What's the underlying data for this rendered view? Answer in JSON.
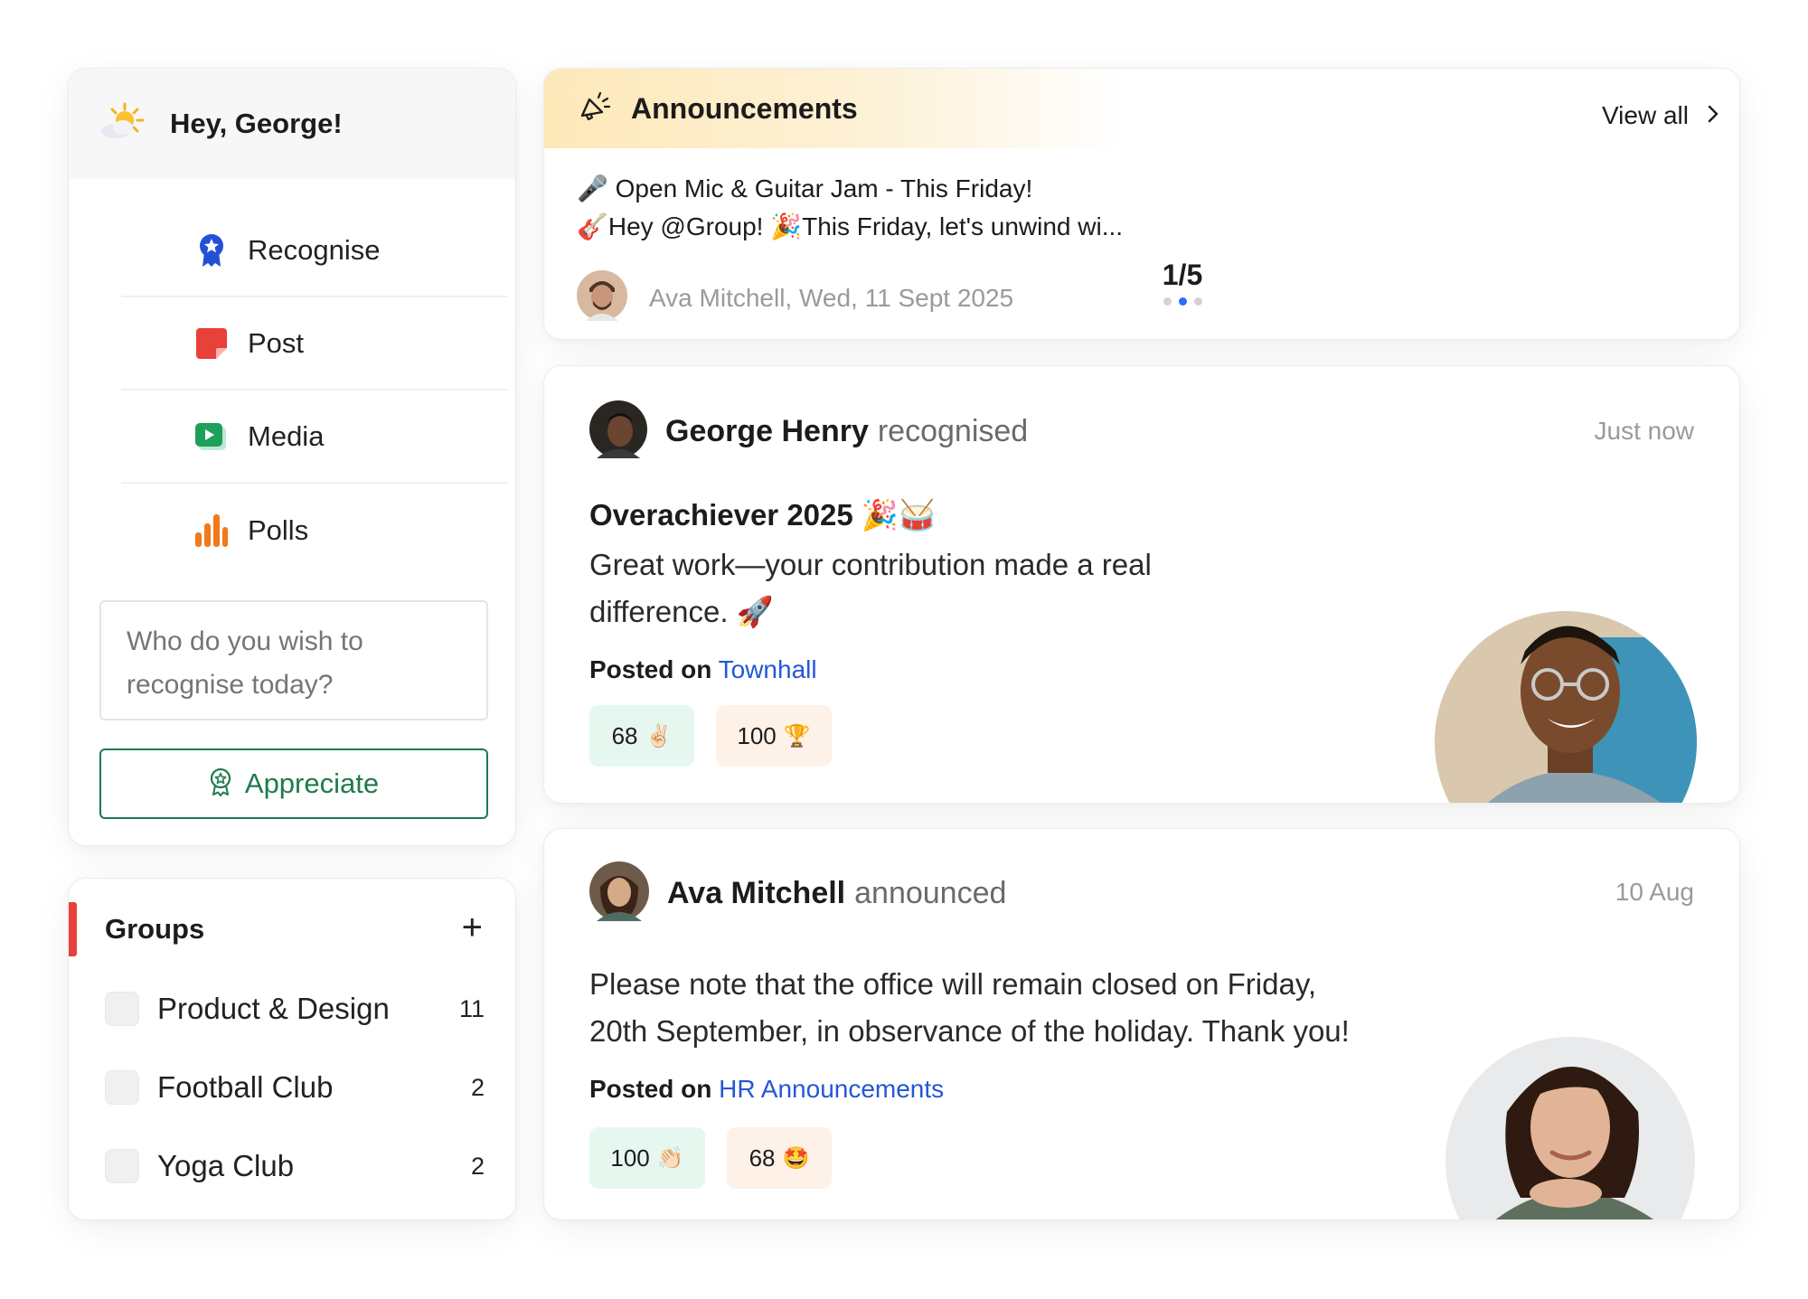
{
  "greeting": {
    "text": "Hey, George!",
    "icon": "sun-cloud-icon"
  },
  "actions": [
    {
      "label": "Recognise",
      "icon": "award-badge-icon",
      "color": "#2350d6"
    },
    {
      "label": "Post",
      "icon": "sticky-note-icon",
      "color": "#e8403a"
    },
    {
      "label": "Media",
      "icon": "play-video-icon",
      "color": "#1ea05a"
    },
    {
      "label": "Polls",
      "icon": "bar-chart-icon",
      "color": "#f07a1a"
    }
  ],
  "recognise_input": {
    "placeholder": "Who do you wish to recognise today?"
  },
  "appreciate": {
    "label": "Appreciate",
    "color": "#1e7a4c"
  },
  "groups": {
    "title": "Groups",
    "add_label": "+",
    "accent": "#e8403a",
    "items": [
      {
        "name": "Product & Design",
        "count": "11"
      },
      {
        "name": "Football Club",
        "count": "2"
      },
      {
        "name": "Yoga Club",
        "count": "2"
      }
    ]
  },
  "announcements": {
    "title": "Announcements",
    "view_all": "View all",
    "line1": "🎤 Open Mic & Guitar Jam - This Friday!",
    "line2": "🎸Hey @Group! 🎉This Friday, let's unwind wi...",
    "author_meta": "Ava Mitchell, Wed, 11 Sept 2025",
    "pager": "1/5",
    "active_dot": 2,
    "dot_count": 3
  },
  "posts": [
    {
      "author": "George Henry",
      "verb": "recognised",
      "time": "Just now",
      "title": "Overachiever 2025 🎉🥁",
      "text_line1": "Great work—your contribution made a real",
      "text_line2": "difference. 🚀",
      "posted_on_label": "Posted on",
      "posted_on": "Townhall",
      "reactions": [
        {
          "count": "68",
          "emoji": "✌🏻"
        },
        {
          "count": "100",
          "emoji": "🏆"
        }
      ]
    },
    {
      "author": "Ava Mitchell",
      "verb": "announced",
      "time": "10 Aug",
      "text_line1": "Please note that the office will remain closed on Friday,",
      "text_line2": "20th September, in observance of the holiday. Thank you!",
      "posted_on_label": "Posted on",
      "posted_on": "HR Announcements",
      "reactions": [
        {
          "count": "100",
          "emoji": "👏🏻"
        },
        {
          "count": "68",
          "emoji": "🤩"
        }
      ]
    }
  ],
  "colors": {
    "link": "#2357d6",
    "pager_active": "#2d6bff",
    "announcement_banner": "#fde8b8"
  }
}
